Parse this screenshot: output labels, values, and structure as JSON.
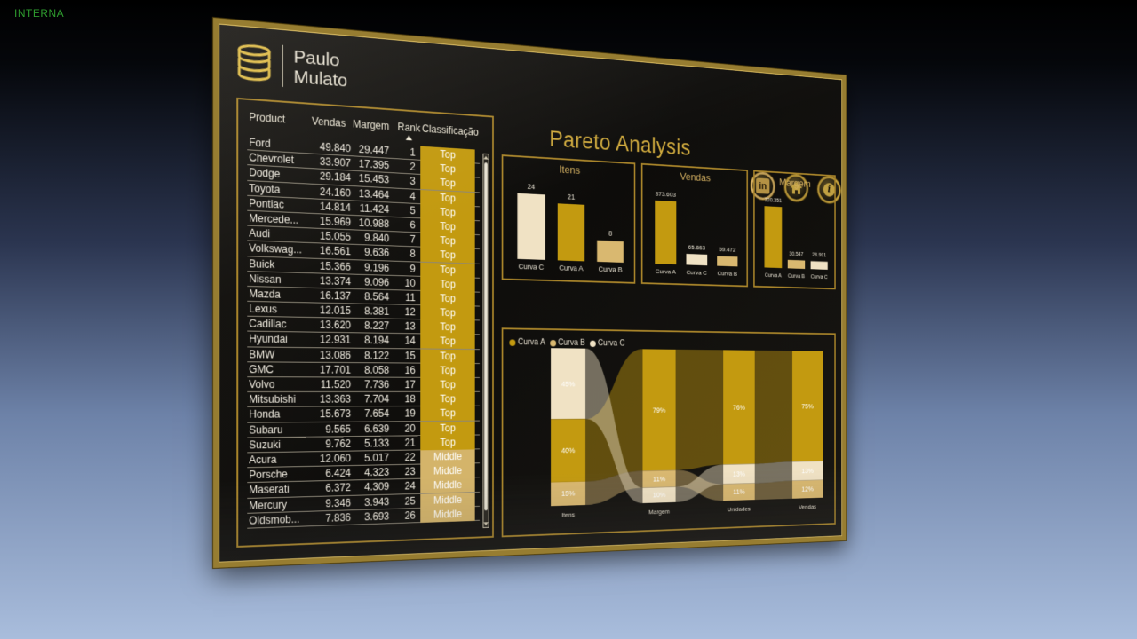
{
  "corner_label": "INTERNA",
  "logo": {
    "line1": "Paulo",
    "line2": "Mulato",
    "icon": "database-icon"
  },
  "title": "Pareto Analysis",
  "colors": {
    "curva_a": "#c39a10",
    "curva_b": "#d9b870",
    "curva_c": "#f0e2c4",
    "frame": "#9a7a1e"
  },
  "table": {
    "headers": {
      "product": "Product",
      "vendas": "Vendas",
      "margem": "Margem",
      "rank": "Rank",
      "classificacao": "Classificação"
    },
    "rows": [
      [
        "Ford",
        "49.840",
        "29.447",
        "1",
        "Top"
      ],
      [
        "Chevrolet",
        "33.907",
        "17.395",
        "2",
        "Top"
      ],
      [
        "Dodge",
        "29.184",
        "15.453",
        "3",
        "Top"
      ],
      [
        "Toyota",
        "24.160",
        "13.464",
        "4",
        "Top"
      ],
      [
        "Pontiac",
        "14.814",
        "11.424",
        "5",
        "Top"
      ],
      [
        "Mercede...",
        "15.969",
        "10.988",
        "6",
        "Top"
      ],
      [
        "Audi",
        "15.055",
        "9.840",
        "7",
        "Top"
      ],
      [
        "Volkswag...",
        "16.561",
        "9.636",
        "8",
        "Top"
      ],
      [
        "Buick",
        "15.366",
        "9.196",
        "9",
        "Top"
      ],
      [
        "Nissan",
        "13.374",
        "9.096",
        "10",
        "Top"
      ],
      [
        "Mazda",
        "16.137",
        "8.564",
        "11",
        "Top"
      ],
      [
        "Lexus",
        "12.015",
        "8.381",
        "12",
        "Top"
      ],
      [
        "Cadillac",
        "13.620",
        "8.227",
        "13",
        "Top"
      ],
      [
        "Hyundai",
        "12.931",
        "8.194",
        "14",
        "Top"
      ],
      [
        "BMW",
        "13.086",
        "8.122",
        "15",
        "Top"
      ],
      [
        "GMC",
        "17.701",
        "8.058",
        "16",
        "Top"
      ],
      [
        "Volvo",
        "11.520",
        "7.736",
        "17",
        "Top"
      ],
      [
        "Mitsubishi",
        "13.363",
        "7.704",
        "18",
        "Top"
      ],
      [
        "Honda",
        "15.673",
        "7.654",
        "19",
        "Top"
      ],
      [
        "Subaru",
        "9.565",
        "6.639",
        "20",
        "Top"
      ],
      [
        "Suzuki",
        "9.762",
        "5.133",
        "21",
        "Top"
      ],
      [
        "Acura",
        "12.060",
        "5.017",
        "22",
        "Middle"
      ],
      [
        "Porsche",
        "6.424",
        "4.323",
        "23",
        "Middle"
      ],
      [
        "Maserati",
        "6.372",
        "4.309",
        "24",
        "Middle"
      ],
      [
        "Mercury",
        "9.346",
        "3.943",
        "25",
        "Middle"
      ],
      [
        "Oldsmob...",
        "7.836",
        "3.693",
        "26",
        "Middle"
      ]
    ]
  },
  "nav_icons": [
    "linkedin-icon",
    "home-icon",
    "info-icon",
    "chart-icon"
  ],
  "chart_data": [
    {
      "type": "bar",
      "title": "Itens",
      "categories": [
        "Curva C",
        "Curva A",
        "Curva B"
      ],
      "values": [
        24,
        21,
        8
      ],
      "labels": [
        "24",
        "21",
        "8"
      ],
      "colors": [
        "#f0e2c4",
        "#c39a10",
        "#d9b870"
      ]
    },
    {
      "type": "bar",
      "title": "Vendas",
      "categories": [
        "Curva A",
        "Curva C",
        "Curva B"
      ],
      "values": [
        373603,
        65663,
        59472
      ],
      "labels": [
        "373.603",
        "65.663",
        "59.472"
      ],
      "colors": [
        "#c39a10",
        "#f0e2c4",
        "#d9b870"
      ]
    },
    {
      "type": "bar",
      "title": "Margem",
      "categories": [
        "Curva A",
        "Curva B",
        "Curva C"
      ],
      "values": [
        220351,
        30547,
        28991
      ],
      "labels": [
        "220.351",
        "30.547",
        "28.991"
      ],
      "colors": [
        "#c39a10",
        "#d9b870",
        "#f0e2c4"
      ]
    },
    {
      "type": "bar",
      "subtype": "ribbon-stacked-100",
      "legend": [
        "Curva A",
        "Curva B",
        "Curva C"
      ],
      "categories": [
        "Itens",
        "Margem",
        "Unidades",
        "Vendas"
      ],
      "series": [
        {
          "name": "Curva A",
          "values": [
            40,
            79,
            76,
            75
          ],
          "labels": [
            "40%",
            "79%",
            "76%",
            "75%"
          ]
        },
        {
          "name": "Curva B",
          "values": [
            15,
            11,
            11,
            12
          ],
          "labels": [
            "15%",
            "11%",
            "11%",
            "12%"
          ]
        },
        {
          "name": "Curva C",
          "values": [
            45,
            10,
            13,
            13
          ],
          "labels": [
            "45%",
            "10%",
            "13%",
            "13%"
          ]
        }
      ],
      "ylim": [
        0,
        100
      ]
    }
  ]
}
